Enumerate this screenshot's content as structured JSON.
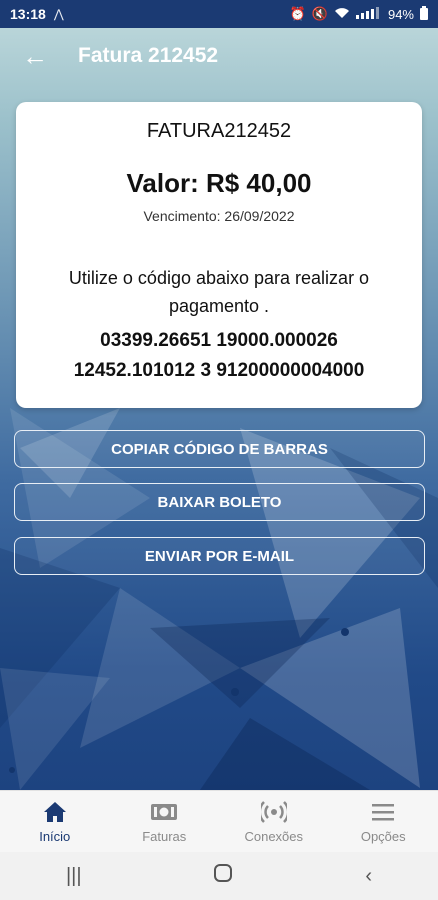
{
  "status_bar": {
    "time": "13:18",
    "battery": "94%"
  },
  "app_bar": {
    "title": "Fatura 212452"
  },
  "invoice": {
    "label": "FATURA212452",
    "value": "Valor: R$ 40,00",
    "due": "Vencimento: 26/09/2022",
    "instruction": "Utilize o código abaixo para realizar o pagamento .",
    "barcode_line1": "03399.26651 19000.000026",
    "barcode_line2": "12452.101012 3 91200000004000"
  },
  "actions": {
    "copy": "COPIAR CÓDIGO DE BARRAS",
    "download": "BAIXAR BOLETO",
    "email": "ENVIAR POR E-MAIL"
  },
  "bottom_nav": [
    {
      "label": "Início",
      "icon": "home-icon",
      "active": true
    },
    {
      "label": "Faturas",
      "icon": "money-icon",
      "active": false
    },
    {
      "label": "Conexões",
      "icon": "wifi-signal-icon",
      "active": false
    },
    {
      "label": "Opções",
      "icon": "menu-icon",
      "active": false
    }
  ],
  "colors": {
    "primary": "#1b3a73",
    "inactive": "#8a8a8a"
  }
}
